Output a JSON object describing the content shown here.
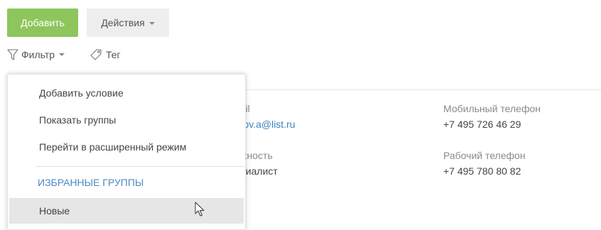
{
  "toolbar": {
    "add_label": "Добавить",
    "actions_label": "Действия"
  },
  "filter_bar": {
    "filter_label": "Фильтр",
    "tag_label": "Тег"
  },
  "contact_details": {
    "email": {
      "label": "nail",
      "value": "orov.a@list.ru"
    },
    "mobile_phone": {
      "label": "Мобильный телефон",
      "value": "+7 495 726 46 29"
    },
    "position": {
      "label": "лжность",
      "value": "ециалист"
    },
    "work_phone": {
      "label": "Рабочий телефон",
      "value": "+7 495 780 80 82"
    }
  },
  "filter_menu": {
    "items": [
      {
        "label": "Добавить условие"
      },
      {
        "label": "Показать группы"
      },
      {
        "label": "Перейти в расширенный режим"
      }
    ],
    "favorites_header": "ИЗБРАННЫЕ ГРУППЫ",
    "favorites": [
      {
        "label": "Новые"
      }
    ]
  },
  "colors": {
    "add_button": "#8ec55c",
    "link": "#3b84c4",
    "section_header": "#4a8ac2",
    "hover_row": "#e6e6e6"
  },
  "icons": [
    "funnel-icon",
    "tag-icon",
    "caret-down-icon",
    "mouse-pointer-icon"
  ]
}
